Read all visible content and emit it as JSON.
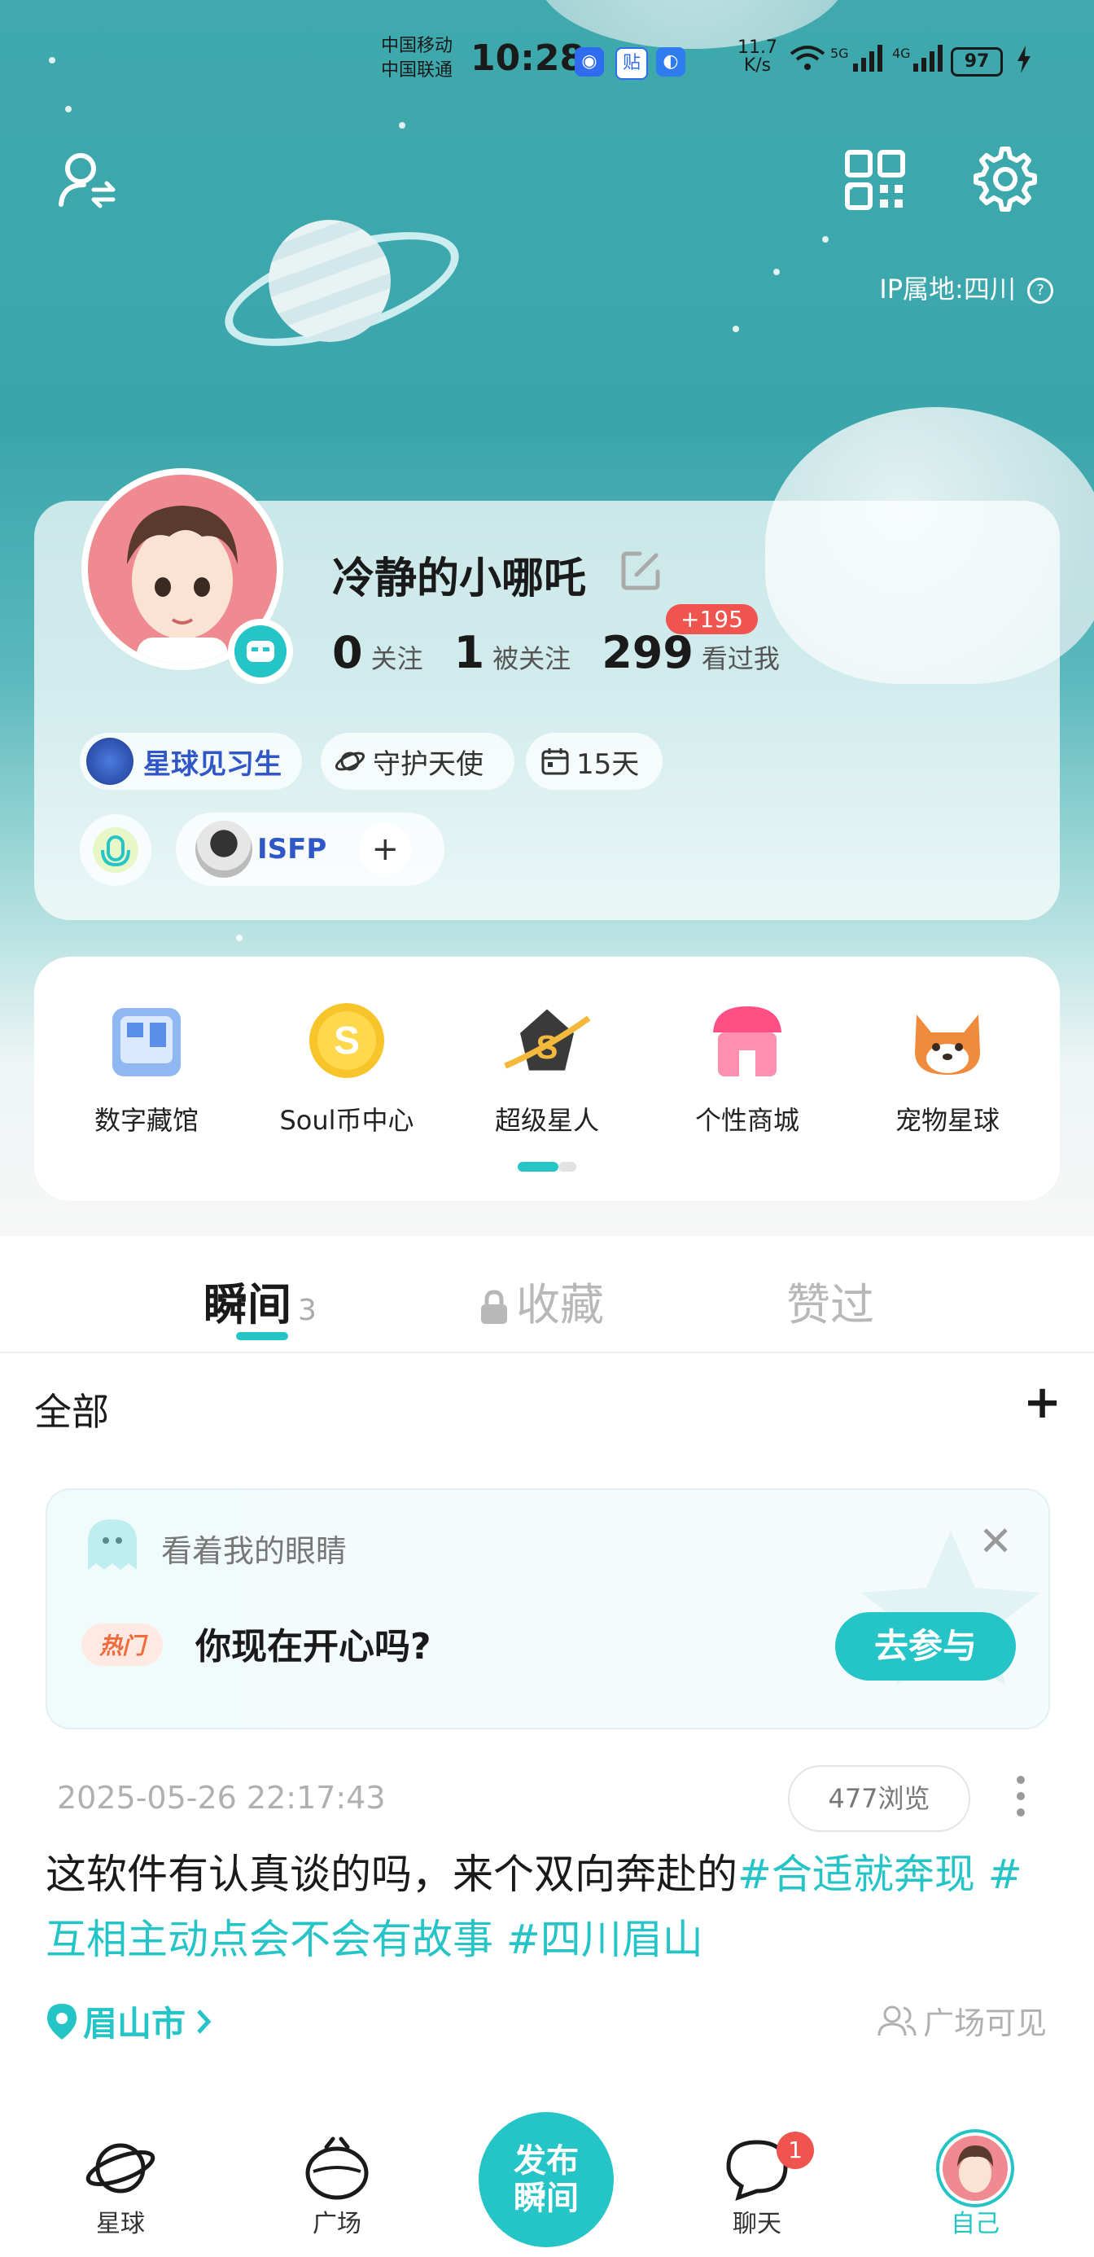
{
  "status_bar": {
    "carrier1": "中国移动",
    "carrier2": "中国联通",
    "time": "10:28",
    "net_speed_value": "11.7",
    "net_speed_unit": "K/s",
    "sig1": "5G",
    "sig2": "4G",
    "battery": "97"
  },
  "header": {
    "ip_location": "IP属地:四川"
  },
  "profile": {
    "nickname": "冷静的小哪吒",
    "following_count": "0",
    "following_label": "关注",
    "followers_count": "1",
    "followers_label": "被关注",
    "visitors_count": "299",
    "visitors_label": "看过我",
    "visitors_delta": "+195",
    "badges": {
      "level": "星球见习生",
      "guardian": "守护天使",
      "days": "15天"
    },
    "mbti": "ISFP",
    "mbti_add": "+"
  },
  "features": [
    {
      "label": "数字藏馆",
      "icon": "museum-icon"
    },
    {
      "label": "Soul币中心",
      "icon": "coin-icon"
    },
    {
      "label": "超级星人",
      "icon": "super-star-icon"
    },
    {
      "label": "个性商城",
      "icon": "shop-icon"
    },
    {
      "label": "宠物星球",
      "icon": "pet-icon"
    }
  ],
  "tabs": {
    "moments": "瞬间",
    "moments_count": "3",
    "favorites": "收藏",
    "liked": "赞过"
  },
  "filter": {
    "label": "全部",
    "add": "+"
  },
  "topic": {
    "title": "看着我的眼睛",
    "hot_tag": "热门",
    "question": "你现在开心吗?",
    "join": "去参与",
    "close": "✕"
  },
  "post": {
    "time": "2025-05-26 22:17:43",
    "views": "477浏览",
    "text_plain": "这软件有认真谈的吗，来个双向奔赴的",
    "tag1": "#合适就奔现 #",
    "tag2": "互相主动点会不会有故事 #四川眉山",
    "location": "眉山市",
    "visibility": "广场可见"
  },
  "bottom_nav": {
    "planet": "星球",
    "square": "广场",
    "publish_line1": "发布",
    "publish_line2": "瞬间",
    "chat": "聊天",
    "chat_badge": "1",
    "me": "自己"
  },
  "colors": {
    "accent": "#25c4c7",
    "badge_red": "#f0544f",
    "hero_top": "#3fa9ad"
  }
}
